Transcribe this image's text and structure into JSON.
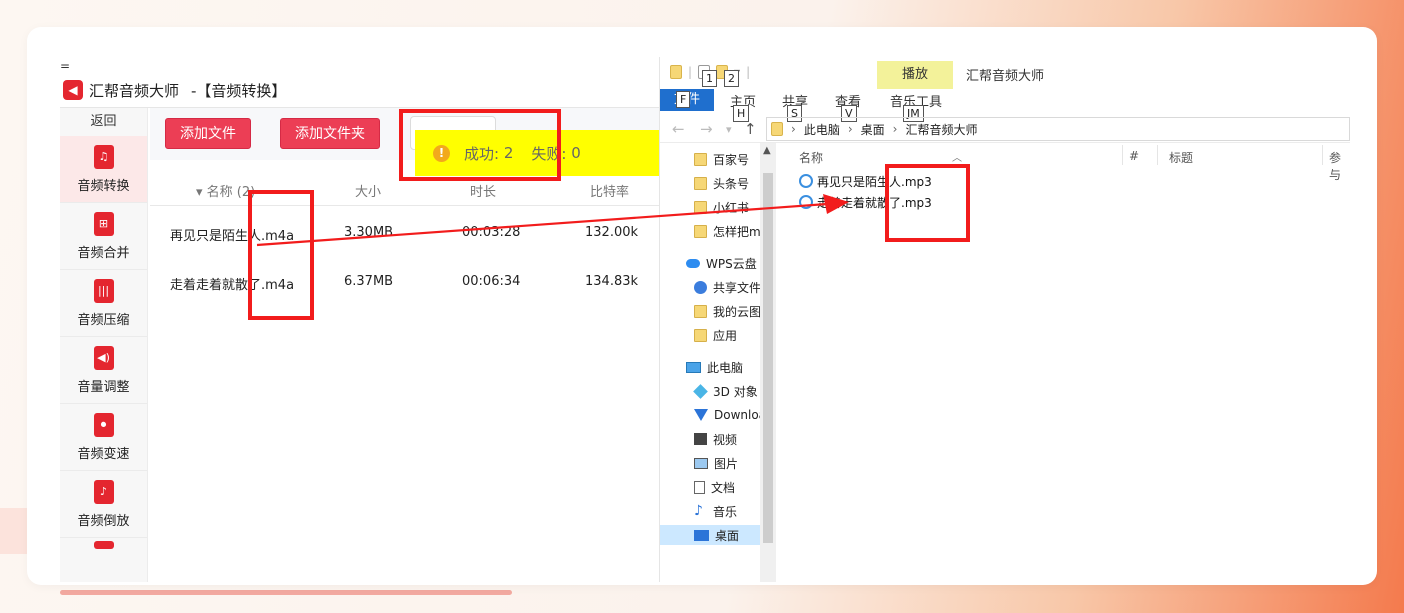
{
  "app": {
    "menu_dash": "=",
    "title": "汇帮音频大师",
    "title_section": "-【音频转换】",
    "back": "返回",
    "sidebar": [
      {
        "label": "音频转换",
        "glyph": "♫"
      },
      {
        "label": "音频合并",
        "glyph": "⊞"
      },
      {
        "label": "音频压缩",
        "glyph": "|||"
      },
      {
        "label": "音量调整",
        "glyph": "◀)"
      },
      {
        "label": "音频变速",
        "glyph": "⏺"
      },
      {
        "label": "音频倒放",
        "glyph": "♪"
      }
    ],
    "toolbar": {
      "add_file": "添加文件",
      "add_folder": "添加文件夹"
    },
    "toast": {
      "success_label": "成功:",
      "success_count": "2",
      "fail_label": "失败:",
      "fail_count": "0",
      "icon": "!"
    },
    "table": {
      "headers": {
        "name": "名称 (2)",
        "size": "大小",
        "duration": "时长",
        "bitrate": "比特率"
      },
      "rows": [
        {
          "name": "再见只是陌生人.m4a",
          "size": "3.30MB",
          "duration": "00:03:28",
          "bitrate": "132.00k"
        },
        {
          "name": "走着走着就散了.m4a",
          "size": "6.37MB",
          "duration": "00:06:34",
          "bitrate": "134.83k"
        }
      ]
    }
  },
  "explorer": {
    "keytips": [
      "1",
      "2",
      "F",
      "H",
      "S",
      "V",
      "JM"
    ],
    "contextual_tab": "播放",
    "window_title": "汇帮音频大师",
    "ribbon": {
      "file": "文件",
      "home": "主页",
      "share": "共享",
      "view": "查看",
      "music_tools": "音乐工具"
    },
    "address": {
      "path": [
        "此电脑",
        "桌面",
        "汇帮音频大师"
      ]
    },
    "nav": [
      {
        "label": "百家号",
        "icon": "folder-icon"
      },
      {
        "label": "头条号",
        "icon": "folder-icon"
      },
      {
        "label": "小红书",
        "icon": "folder-icon"
      },
      {
        "label": "怎样把m",
        "icon": "folder-icon"
      },
      {
        "label": "WPS云盘",
        "icon": "cloud-icon"
      },
      {
        "label": "共享文件",
        "icon": "share-icon"
      },
      {
        "label": "我的云图",
        "icon": "folder-icon"
      },
      {
        "label": "应用",
        "icon": "folder-icon"
      },
      {
        "label": "此电脑",
        "icon": "pc-icon"
      },
      {
        "label": "3D 对象",
        "icon": "cube-icon"
      },
      {
        "label": "Downloa",
        "icon": "download-icon"
      },
      {
        "label": "视频",
        "icon": "video-icon"
      },
      {
        "label": "图片",
        "icon": "picture-icon"
      },
      {
        "label": "文档",
        "icon": "document-icon"
      },
      {
        "label": "音乐",
        "icon": "music-icon"
      },
      {
        "label": "桌面",
        "icon": "desktop-icon"
      }
    ],
    "columns": {
      "name": "名称",
      "number": "#",
      "title": "标题",
      "participant": "参与"
    },
    "files": [
      "再见只是陌生人.mp3",
      "走着走着就散了.mp3"
    ]
  },
  "colors": {
    "accent_red": "#ec3e55",
    "highlight_box": "#f21c1c",
    "toast_bg": "#ffff00",
    "explorer_file_tab": "#1f6fce"
  }
}
